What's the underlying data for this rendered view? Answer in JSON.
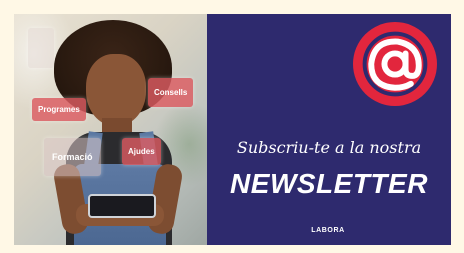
{
  "tags": {
    "programes": "Programes",
    "consells": "Consells",
    "ajudes": "Ajudes",
    "formacio": "Formació"
  },
  "headline": {
    "script_text": "Subscriu-te a la nostra",
    "main_text": "NEWSLETTER"
  },
  "brand": "LABORA",
  "icons": {
    "at_badge": "at-sign-icon"
  },
  "colors": {
    "panel_background": "#2e2a6e",
    "badge_red": "#e2263d",
    "tag_red": "#dc5c62",
    "text": "#ffffff"
  }
}
